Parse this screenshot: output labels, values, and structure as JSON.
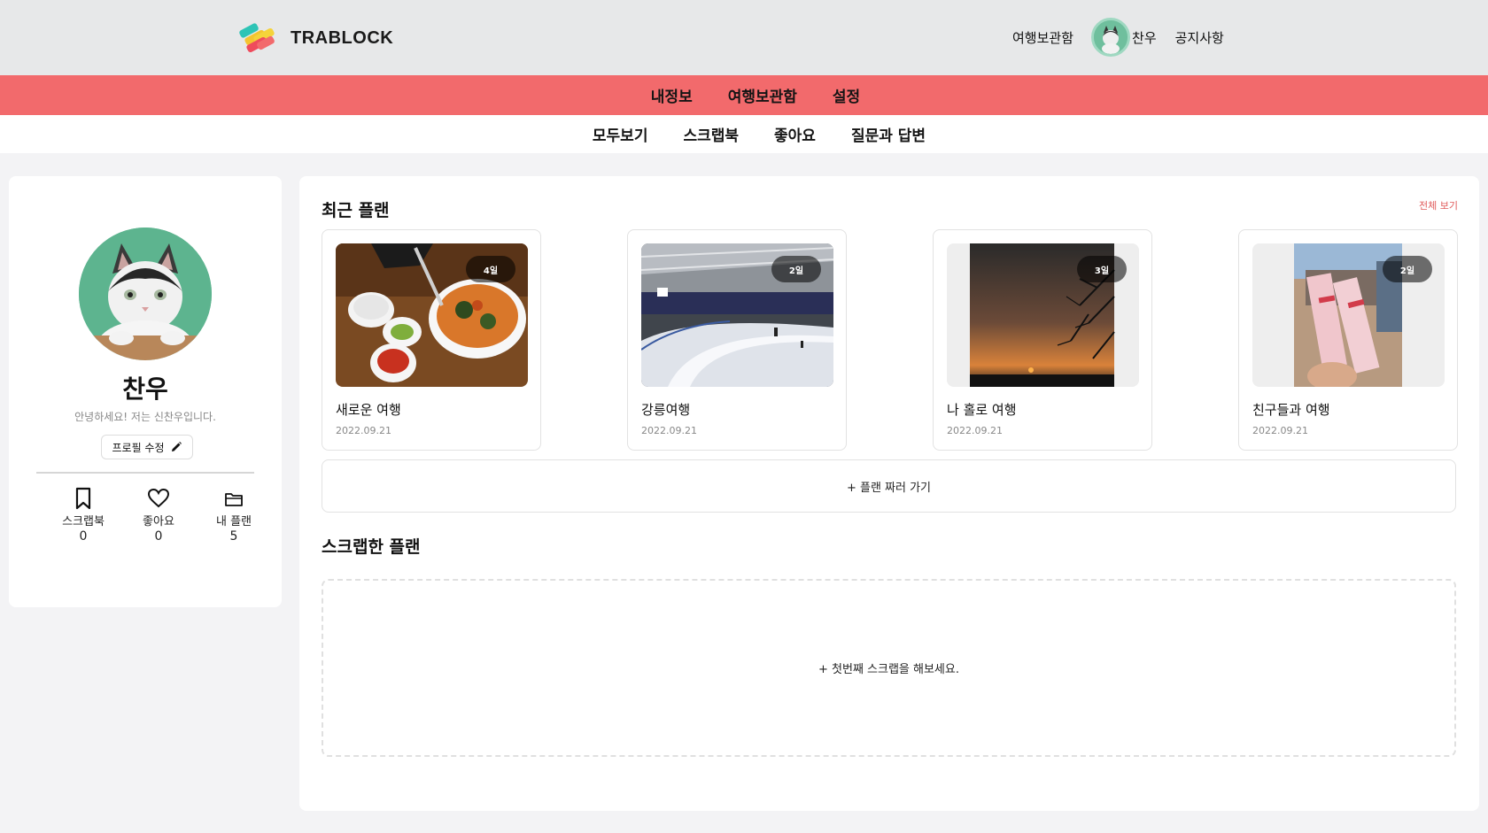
{
  "header": {
    "logo_text": "TRABLOCK",
    "nav_archive": "여행보관함",
    "user_name": "찬우",
    "nav_notice": "공지사항"
  },
  "main_tabs": [
    {
      "label": "내정보"
    },
    {
      "label": "여행보관함"
    },
    {
      "label": "설정"
    }
  ],
  "sub_tabs": [
    {
      "label": "모두보기"
    },
    {
      "label": "스크랩북"
    },
    {
      "label": "좋아요"
    },
    {
      "label": "질문과 답변"
    }
  ],
  "profile": {
    "name": "찬우",
    "bio": "안녕하세요! 저는 신찬우입니다.",
    "edit_label": "프로필 수정",
    "stats": [
      {
        "label": "스크랩북",
        "count": "0",
        "icon": "bookmark-icon"
      },
      {
        "label": "좋아요",
        "count": "0",
        "icon": "heart-icon"
      },
      {
        "label": "내 플랜",
        "count": "5",
        "icon": "folder-icon"
      }
    ]
  },
  "recent": {
    "title": "최근 플랜",
    "see_all": "전체 보기",
    "plans": [
      {
        "name": "새로운 여행",
        "date": "2022.09.21",
        "days": "4일"
      },
      {
        "name": "강릉여행",
        "date": "2022.09.21",
        "days": "2일"
      },
      {
        "name": "나 홀로 여행",
        "date": "2022.09.21",
        "days": "3일"
      },
      {
        "name": "친구들과 여행",
        "date": "2022.09.21",
        "days": "2일"
      }
    ],
    "add_plan": "+ 플랜 짜러 가기"
  },
  "scrap": {
    "title": "스크랩한 플랜",
    "empty": "+ 첫번째 스크랩을 해보세요."
  },
  "colors": {
    "accent": "#f26a6c",
    "header_bg": "#e7e8e9",
    "page_bg": "#f3f3f5",
    "link_red": "#e05a5a"
  }
}
